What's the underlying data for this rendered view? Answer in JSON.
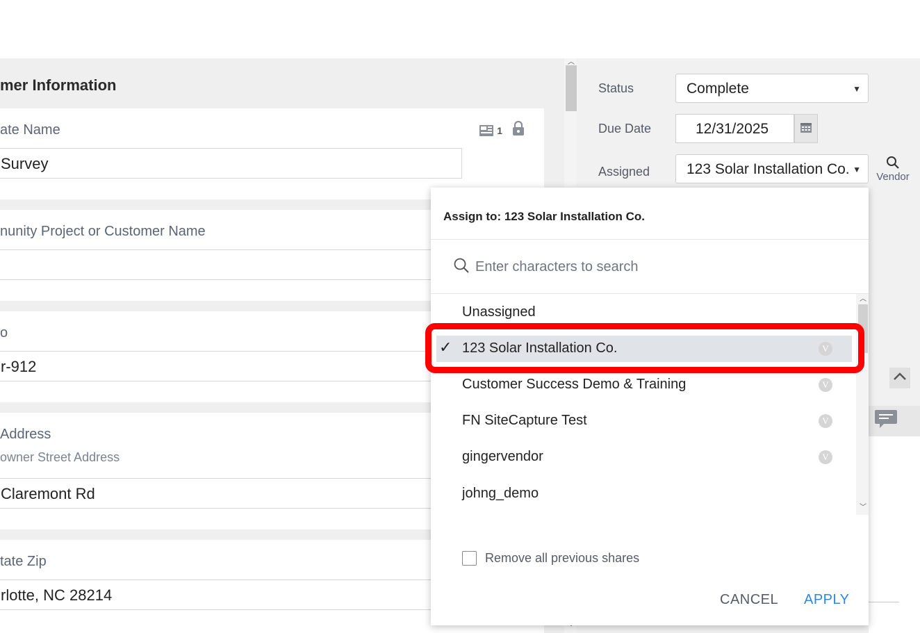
{
  "form": {
    "section_title": "mer Information",
    "fields": [
      {
        "label": "ate Name",
        "value": "Survey",
        "photo_count": "1"
      },
      {
        "label": "nunity Project or Customer Name",
        "value": ""
      },
      {
        "label": "o",
        "value": "r-912"
      },
      {
        "label": " Address",
        "sublabel": "owner Street Address",
        "value": "Claremont Rd"
      },
      {
        "label": "tate Zip",
        "value": "rlotte, NC 28214"
      }
    ]
  },
  "sidebar": {
    "status_label": "Status",
    "status_value": "Complete",
    "due_date_label": "Due Date",
    "due_date_value": "12/31/2025",
    "assigned_label": "Assigned",
    "assigned_value": "123 Solar Installation Co.",
    "vendor_button_label": "Vendor"
  },
  "assign_popup": {
    "title": "Assign to: 123 Solar Installation Co.",
    "search_placeholder": "Enter characters to search",
    "items": [
      {
        "label": "Unassigned",
        "selected": false,
        "vendor_badge": ""
      },
      {
        "label": "123 Solar Installation Co.",
        "selected": true,
        "vendor_badge": "V"
      },
      {
        "label": "Customer Success Demo & Training",
        "selected": false,
        "vendor_badge": "V"
      },
      {
        "label": "FN SiteCapture Test",
        "selected": false,
        "vendor_badge": "V"
      },
      {
        "label": "gingervendor",
        "selected": false,
        "vendor_badge": "V"
      },
      {
        "label": "johng_demo",
        "selected": false,
        "vendor_badge": ""
      }
    ],
    "check_glyph": "✓",
    "remove_shares_label": "Remove all previous shares",
    "cancel_label": "CANCEL",
    "apply_label": "APPLY"
  },
  "colors": {
    "highlight": "#ff0000",
    "apply": "#2e86de",
    "selected_row": "#e0e3e7"
  }
}
